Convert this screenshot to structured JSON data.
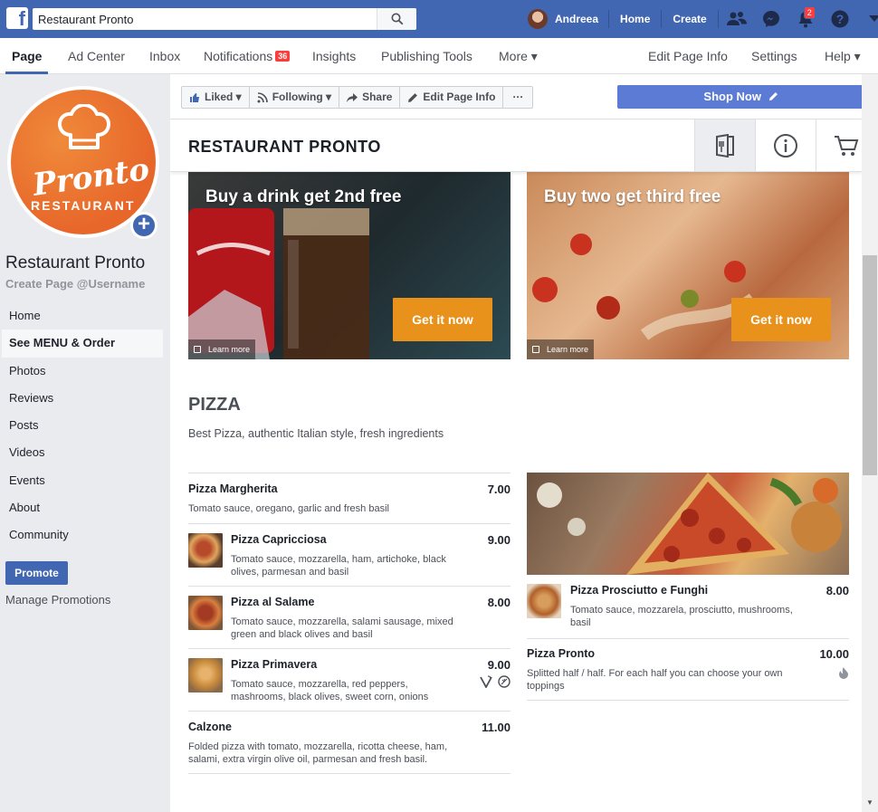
{
  "topbar": {
    "search_value": "Restaurant Pronto",
    "user_name": "Andreea",
    "home": "Home",
    "create": "Create",
    "notifications_count": "2"
  },
  "page_tabs": {
    "page": "Page",
    "ad_center": "Ad Center",
    "inbox": "Inbox",
    "notifications": "Notifications",
    "notifications_count": "36",
    "insights": "Insights",
    "publishing_tools": "Publishing Tools",
    "more": "More ▾",
    "edit_page_info": "Edit Page Info",
    "settings": "Settings",
    "help": "Help ▾"
  },
  "sidebar": {
    "logo_text": "Pronto",
    "logo_subtext": "RESTAURANT",
    "page_name": "Restaurant Pronto",
    "username": "Create Page @Username",
    "items": [
      {
        "label": "Home"
      },
      {
        "label": "See MENU & Order"
      },
      {
        "label": "Photos"
      },
      {
        "label": "Reviews"
      },
      {
        "label": "Posts"
      },
      {
        "label": "Videos"
      },
      {
        "label": "Events"
      },
      {
        "label": "About"
      },
      {
        "label": "Community"
      }
    ],
    "promote": "Promote",
    "manage_promotions": "Manage Promotions"
  },
  "actions": {
    "liked": "Liked",
    "following": "Following",
    "share": "Share",
    "edit_page_info": "Edit Page Info",
    "more": "···",
    "shop_now": "Shop Now"
  },
  "store": {
    "title": "RESTAURANT PRONTO"
  },
  "banners": [
    {
      "title": "Buy a drink get 2nd free",
      "button": "Get it now",
      "learn": "Learn more"
    },
    {
      "title": "Buy two get third free",
      "button": "Get it now",
      "learn": "Learn more"
    }
  ],
  "section": {
    "title": "PIZZA",
    "description": "Best Pizza, authentic Italian style, fresh ingredients"
  },
  "menu_left": [
    {
      "name": "Pizza Margherita",
      "price": "7.00",
      "desc": "Tomato sauce, oregano, garlic and fresh basil"
    },
    {
      "name": "Pizza Capricciosa",
      "price": "9.00",
      "desc": "Tomato sauce, mozzarella, ham, artichoke, black olives, parmesan and basil"
    },
    {
      "name": "Pizza al Salame",
      "price": "8.00",
      "desc": "Tomato sauce, mozzarella, salami sausage, mixed green and black olives and basil"
    },
    {
      "name": "Pizza Primavera",
      "price": "9.00",
      "desc": "Tomato sauce, mozzarella, red peppers, mashrooms, black olives, sweet corn, onions"
    },
    {
      "name": "Calzone",
      "price": "11.00",
      "desc": "Folded pizza with tomato, mozzarella, ricotta cheese, ham, salami, extra virgin olive oil, parmesan and fresh basil."
    }
  ],
  "menu_right": [
    {
      "name": "Pizza Prosciutto e Funghi",
      "price": "8.00",
      "desc": "Tomato sauce, mozzarela, prosciutto, mushrooms, basil"
    },
    {
      "name": "Pizza Pronto",
      "price": "10.00",
      "desc": "Splitted half / half. For each half you can choose your own toppings"
    }
  ],
  "colors": {
    "brand_blue": "#4267b2",
    "accent_orange": "#e8921c",
    "badge_red": "#fa3e3e"
  }
}
